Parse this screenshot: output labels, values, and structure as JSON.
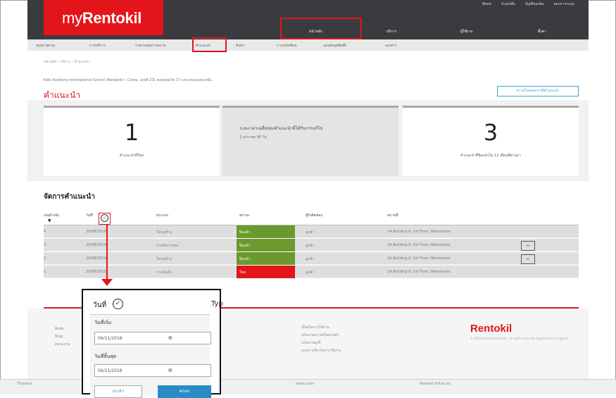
{
  "app": {
    "logo_prefix": "my",
    "logo_brand": "Rentokil"
  },
  "top_links": [
    "ติดต่อ",
    "ช่วยเหลือ",
    "บัญชีของฉัน",
    "ออกจากระบบ"
  ],
  "top_nav": [
    "หน้าหลัก",
    "บริการ",
    "ผู้ใช้งาน",
    "ตั้งค่า"
  ],
  "sub_nav": [
    "สรุปภาพรวม",
    "การบริการ",
    "รายงานผลการตรวจ",
    "คำแนะนำ",
    "ค้นหา",
    "การแจ้งเตือน",
    "แผนผังจุดติดตั้ง",
    "เอกสาร"
  ],
  "breadcrumb": "หน้าหลัก  ›  บริการ  ›  คำแนะนำ",
  "account_line": "Kids Academy International School (Bangkok) - Camp, เลขที่ 231 ซอยสุขุมวิท 17 แขวงคลองเตยเหนือ",
  "page_title": "คำแนะนำ",
  "history_button": "ดาวน์โหลดประวัติคำแนะนำ",
  "cards": {
    "left": {
      "number": "1",
      "label": "คำแนะนำที่ใหม่"
    },
    "middle": {
      "title": "ระยะเวลาเฉลี่ยของคำแนะนำที่ได้รับการแก้ไข",
      "sub": "1 มกราคม 90 วัน"
    },
    "right": {
      "number": "3",
      "label": "คำแนะนำที่ปิดแล้วใน 12 เดือนที่ผ่านมา"
    }
  },
  "section_title": "จัดการคำแนะนำ",
  "table": {
    "headers": [
      "เลขอ้างอิง",
      "วันที่",
      "ประเภท",
      "สถานะ",
      "ผู้รับผิดชอบ",
      "สถานที่"
    ],
    "rows": [
      {
        "ref": "4",
        "date": "20/08/2019",
        "type": "โครงสร้าง",
        "status": "ปิดแล้ว",
        "status_color": "#6a9a2e",
        "owner": "ลูกค้า",
        "location": "1A Building A, 1st Floor, Warehouse",
        "image": false
      },
      {
        "ref": "3",
        "date": "20/08/2019",
        "type": "การจัดการขยะ",
        "status": "ปิดแล้ว",
        "status_color": "#6a9a2e",
        "owner": "ลูกค้า",
        "location": "1A Building A, 1st Floor, Warehouse",
        "image": true
      },
      {
        "ref": "2",
        "date": "20/08/2019",
        "type": "โครงสร้าง",
        "status": "ปิดแล้ว",
        "status_color": "#6a9a2e",
        "owner": "ลูกค้า",
        "location": "1A Building A, 1st Floor, Warehouse",
        "image": true
      },
      {
        "ref": "1",
        "date": "20/08/2019",
        "type": "การจัดเก็บ",
        "status": "ใหม่",
        "status_color": "#e3151a",
        "owner": "ลูกค้า",
        "location": "1A Building A, 1st Floor, Warehouse",
        "image": false
      }
    ]
  },
  "popup": {
    "header": "วันที่",
    "type_header": "Typ",
    "from_label": "วันที่เริ่ม",
    "from_value": "06/11/2018",
    "to_label": "วันที่สิ้นสุด",
    "to_value": "06/11/2018",
    "cancel": "ยกเลิก",
    "ok": "ตกลง"
  },
  "footer": {
    "left_lines": [
      "ติดต่อ",
      "Blog",
      "ตลาดงาน"
    ],
    "mid_lines": [
      "เงื่อนไขการใช้งาน",
      "นโยบายความเป็นส่วนตัว",
      "นโยบายคุกกี้",
      "เอกสารเกี่ยวกับการใช้งาน"
    ],
    "brand": "Rentokil",
    "brand_text": "© 2019 Rentokil Initial plc. All rights reserved. Registered in England."
  },
  "bottom": [
    "Thailand",
    "initial.com",
    "Rentokil Initial plc"
  ],
  "colors": {
    "brand_red": "#e3151a",
    "dark": "#3a3b3f",
    "link_blue": "#46a0c8",
    "ok_blue": "#2a8bc4",
    "closed_green": "#6a9a2e"
  }
}
